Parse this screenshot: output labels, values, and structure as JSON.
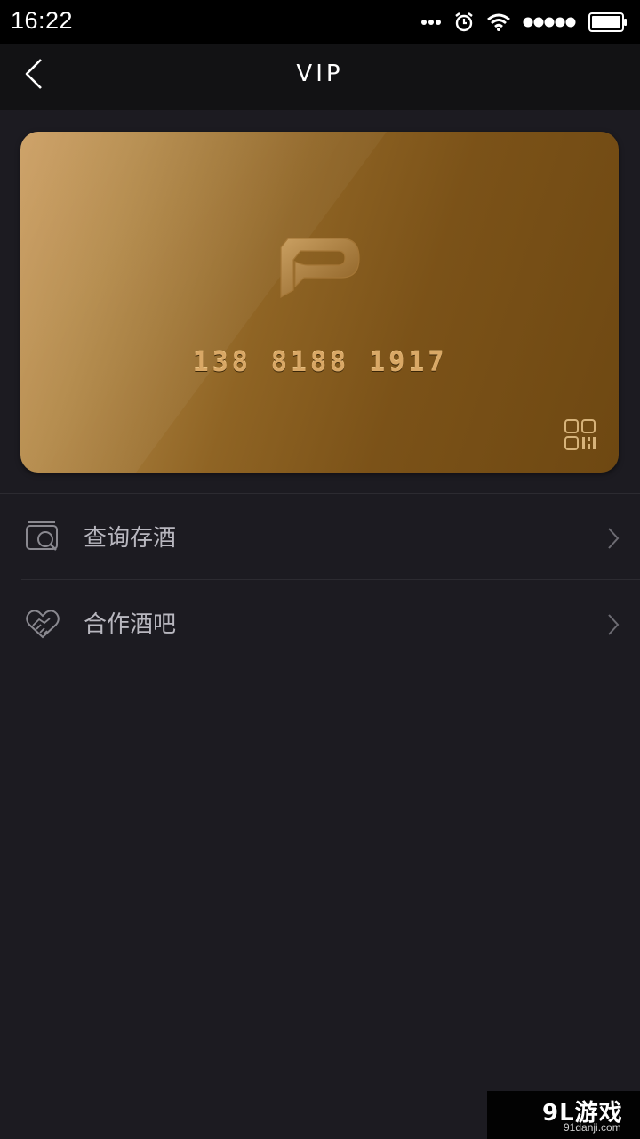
{
  "status_bar": {
    "time": "16:22",
    "icons": [
      "more-dots-icon",
      "alarm-icon",
      "wifi-icon",
      "signal-dots-icon",
      "battery-icon"
    ]
  },
  "nav": {
    "title": "VIP",
    "back_icon": "chevron-left-icon"
  },
  "card": {
    "number": "138 8188 1917",
    "logo": "P",
    "qr_icon": "qr-code-icon",
    "colors": {
      "gold_light": "#c9995a",
      "gold_dark": "#6e4812",
      "number": "#d9a866"
    }
  },
  "menu": {
    "items": [
      {
        "label": "查询存酒",
        "icon": "wine-search-icon"
      },
      {
        "label": "合作酒吧",
        "icon": "handshake-icon"
      }
    ]
  },
  "watermark": {
    "main": "9L游戏",
    "sub": "91danji.com"
  },
  "colors": {
    "background": "#1c1b21",
    "nav_background": "#121214",
    "divider": "#2c2b31",
    "label": "#b8b7bf"
  }
}
